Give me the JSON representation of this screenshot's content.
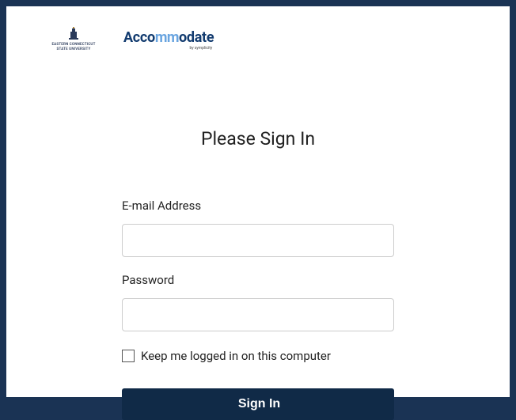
{
  "logos": {
    "university": {
      "name": "EASTERN CONNECTICUT STATE UNIVERSITY"
    },
    "product": {
      "text_before": "Acco",
      "text_mm": "mm",
      "text_after": "odate",
      "byline": "by symplicity"
    }
  },
  "heading": "Please Sign In",
  "form": {
    "email_label": "E-mail Address",
    "email_value": "",
    "password_label": "Password",
    "password_value": "",
    "remember_label": "Keep me logged in on this computer",
    "submit_label": "Sign In"
  }
}
